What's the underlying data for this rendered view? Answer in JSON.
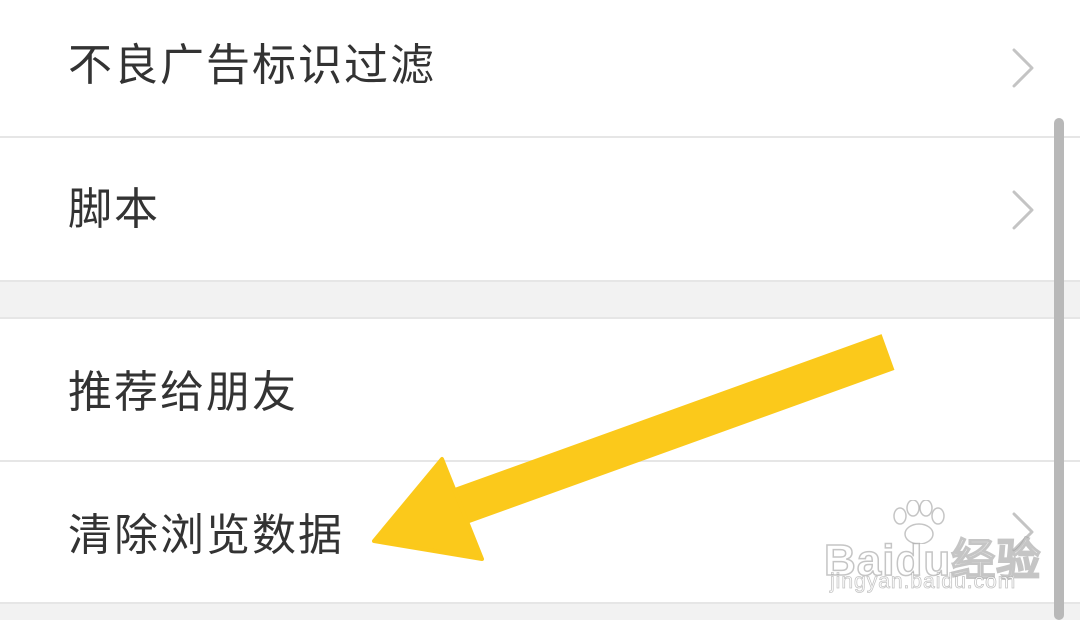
{
  "settings": {
    "items": [
      {
        "label": "不良广告标识过滤",
        "icon": "chevron-right-icon"
      },
      {
        "label": "脚本",
        "icon": "chevron-right-icon"
      },
      {
        "label": "推荐给朋友"
      },
      {
        "label": "清除浏览数据",
        "icon": "chevron-right-icon"
      }
    ]
  },
  "annotation": {
    "arrow_color": "#FBC91B",
    "icon": "arrow-pointer-icon"
  },
  "watermark": {
    "brand": "Baidu经验",
    "url": "jingyan.baidu.com",
    "icon": "paw-logo-icon"
  },
  "colors": {
    "text": "#333333",
    "divider": "#e6e6e6",
    "section_gap": "#f2f2f2",
    "chevron": "#c4c4c4"
  }
}
